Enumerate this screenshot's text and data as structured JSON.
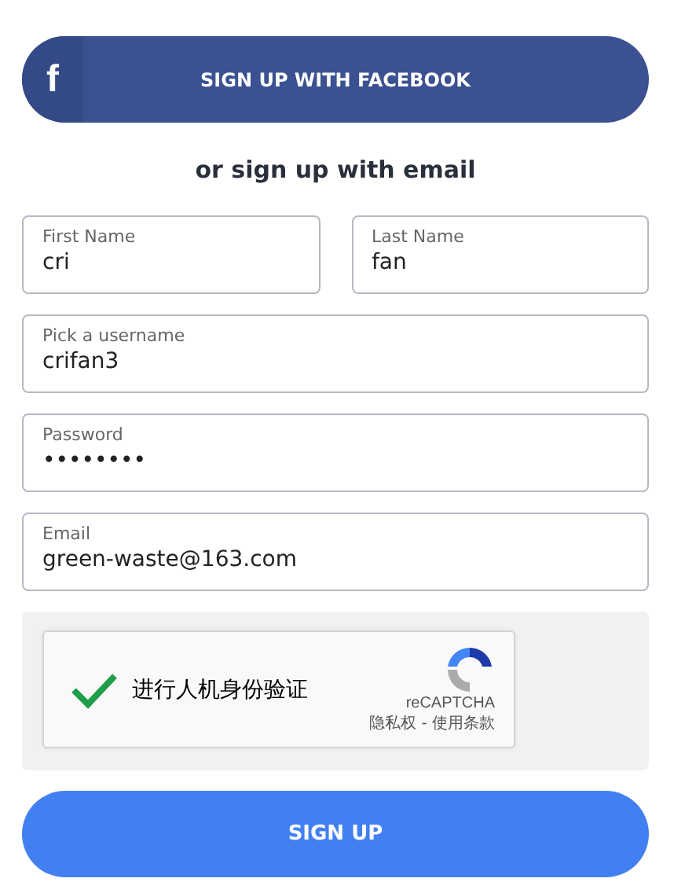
{
  "facebook_button": {
    "icon": "f",
    "label": "SIGN UP WITH FACEBOOK"
  },
  "divider_text": "or sign up with email",
  "fields": [
    {
      "label": "First Name",
      "value": "cri",
      "half": true
    },
    {
      "label": "Last Name",
      "value": "fan",
      "half": true
    },
    {
      "label": "Pick a username",
      "value": "crifan3",
      "half": false
    },
    {
      "label": "Password",
      "value": "••••••••",
      "half": false
    },
    {
      "label": "Email",
      "value": "green-waste@163.com",
      "half": false
    }
  ],
  "captcha": {
    "checked": true,
    "label": "进行人机身份验证",
    "brand": "reCAPTCHA",
    "links": "隐私权 - 使用条款"
  },
  "submit_button": "SIGN UP"
}
